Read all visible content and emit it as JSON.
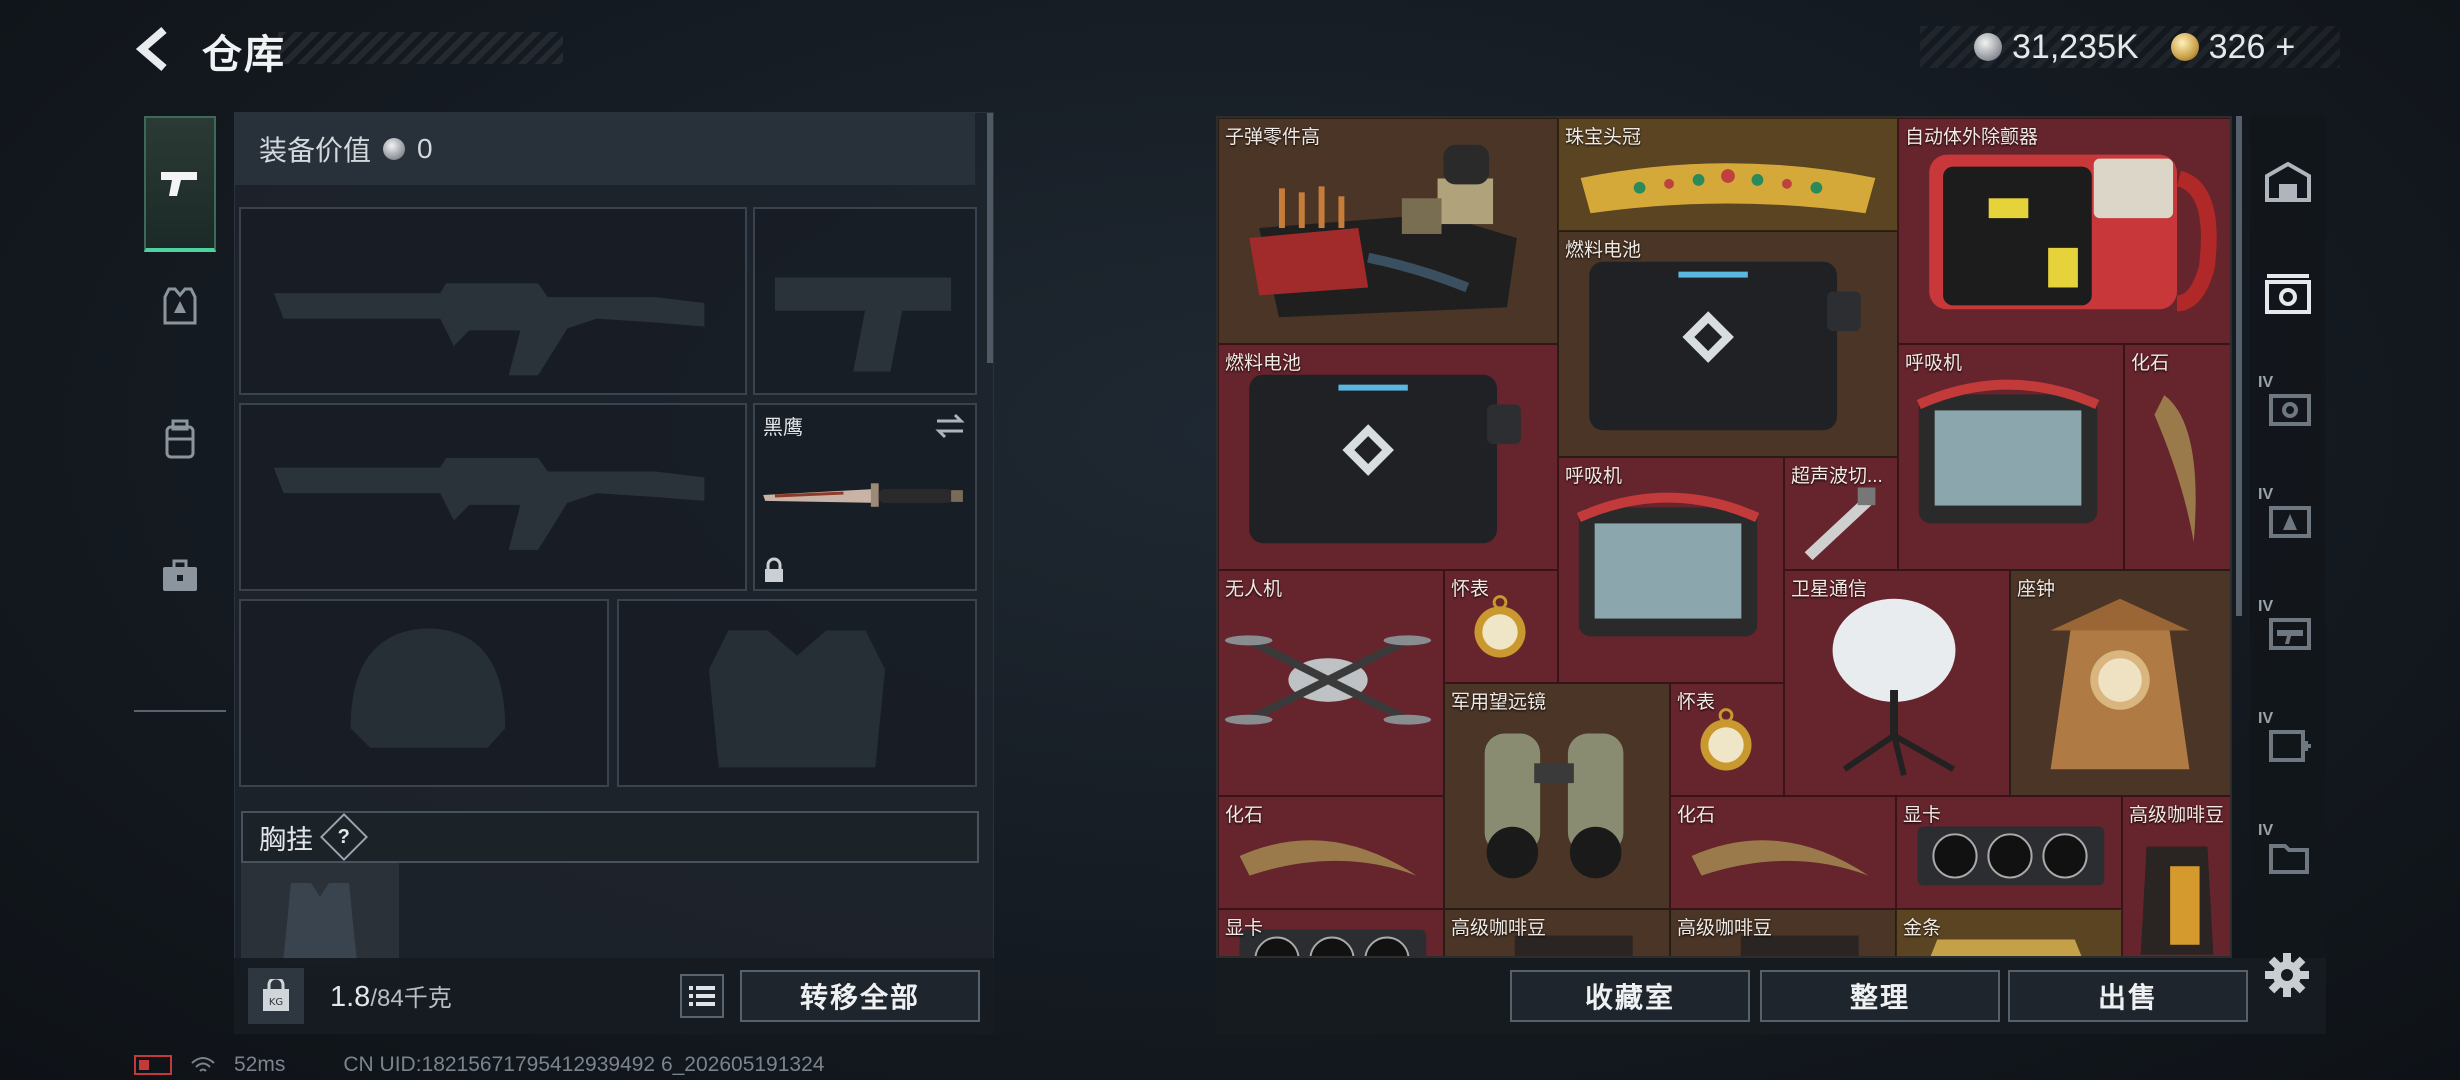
{
  "header": {
    "title": "仓库",
    "silver_amount": "31,235K",
    "gold_amount": "326",
    "gold_plus": "+"
  },
  "equipment": {
    "value_label": "装备价值",
    "value": "0",
    "knife_name": "黑鹰",
    "chest_label": "胸挂",
    "help_symbol": "?"
  },
  "inventory": {
    "weight_current": "1.8",
    "weight_max": "/84千克",
    "transfer_all_label": "转移全部"
  },
  "storage": {
    "items": [
      {
        "name": "子弹零件高"
      },
      {
        "name": "珠宝头冠"
      },
      {
        "name": "自动体外除颤器"
      },
      {
        "name": "燃料电池"
      },
      {
        "name": "燃料电池"
      },
      {
        "name": "呼吸机"
      },
      {
        "name": "化石"
      },
      {
        "name": "呼吸机"
      },
      {
        "name": "超声波切..."
      },
      {
        "name": "无人机"
      },
      {
        "name": "怀表"
      },
      {
        "name": "卫星通信"
      },
      {
        "name": "座钟"
      },
      {
        "name": "军用望远镜"
      },
      {
        "name": "怀表"
      },
      {
        "name": "化石"
      },
      {
        "name": "化石"
      },
      {
        "name": "显卡"
      },
      {
        "name": "高级咖啡豆"
      },
      {
        "name": "显卡"
      },
      {
        "name": "高级咖啡豆"
      },
      {
        "name": "高级咖啡豆"
      },
      {
        "name": "金条"
      }
    ],
    "collection_label": "收藏室",
    "sort_label": "整理",
    "sell_label": "出售"
  },
  "right_tabs": {
    "levels": [
      "IV",
      "IV",
      "IV",
      "IV",
      "IV"
    ]
  },
  "status_bar": {
    "ping": "52ms",
    "uid": "CN UID:18215671795412939492 6_202605191324"
  },
  "colors": {
    "storage_bg": "#6a2a32",
    "active_tab_accent": "#4fd1a0"
  }
}
